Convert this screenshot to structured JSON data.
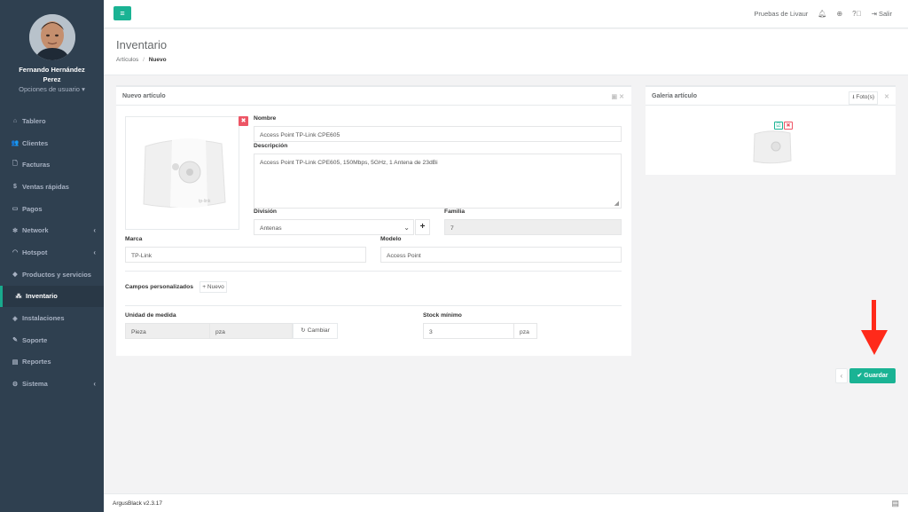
{
  "user": {
    "name": "Fernando Hernández Perez",
    "options": "Opciones de usuario"
  },
  "nav": [
    {
      "label": "Tablero",
      "icon": "dashboard-icon",
      "glyph": "⌂",
      "chevron": ""
    },
    {
      "label": "Clientes",
      "icon": "users-icon",
      "glyph": "👥",
      "chevron": ""
    },
    {
      "label": "Facturas",
      "icon": "document-icon",
      "glyph": "🗋",
      "chevron": ""
    },
    {
      "label": "Ventas rápidas",
      "icon": "dollar-icon",
      "glyph": "$",
      "chevron": ""
    },
    {
      "label": "Pagos",
      "icon": "money-icon",
      "glyph": "▭",
      "chevron": ""
    },
    {
      "label": "Network",
      "icon": "network-icon",
      "glyph": "✻",
      "chevron": "‹"
    },
    {
      "label": "Hotspot",
      "icon": "wifi-icon",
      "glyph": "◠",
      "chevron": "‹"
    },
    {
      "label": "Productos y servicios",
      "icon": "tag-icon",
      "glyph": "◆",
      "chevron": ""
    },
    {
      "label": "Inventario",
      "icon": "cubes-icon",
      "glyph": "⁂",
      "chevron": "",
      "active": true
    },
    {
      "label": "Instalaciones",
      "icon": "install-icon",
      "glyph": "◈",
      "chevron": ""
    },
    {
      "label": "Soporte",
      "icon": "wrench-icon",
      "glyph": "✎",
      "chevron": ""
    },
    {
      "label": "Reportes",
      "icon": "book-icon",
      "glyph": "▤",
      "chevron": ""
    },
    {
      "label": "Sistema",
      "icon": "gears-icon",
      "glyph": "⚙",
      "chevron": "‹"
    }
  ],
  "topbar": {
    "account": "Pruebas de Livaur",
    "logout": "Salir"
  },
  "page": {
    "title": "Inventario",
    "crumb_parent": "Artículos",
    "crumb_sep": "/",
    "crumb_current": "Nuevo"
  },
  "form": {
    "panel_title": "Nuevo artículo",
    "nombre_label": "Nombre",
    "nombre_value": "Access Point TP-Link CPE605",
    "descripcion_label": "Descripción",
    "descripcion_value": "Access Point TP-Link CPE605, 150Mbps, 5GHz, 1 Antena de 23dBi",
    "division_label": "División",
    "division_value": "Antenas",
    "familia_label": "Familia",
    "familia_value": "7",
    "marca_label": "Marca",
    "marca_value": "TP-Link",
    "modelo_label": "Modelo",
    "modelo_value": "Access Point",
    "campos_label": "Campos personalizados",
    "campos_new": "Nuevo",
    "unidad_label": "Unidad de medida",
    "unidad_value": "Pieza",
    "unidad_abbr": "pza",
    "cambiar": "Cambiar",
    "stock_label": "Stock mínimo",
    "stock_value": "3",
    "stock_unit": "pza",
    "product_brand_mark": "tp-link"
  },
  "gallery": {
    "title": "Galeria artículo",
    "fotos": "Foto(s)"
  },
  "actions": {
    "save": "Guardar"
  },
  "footer": {
    "version": "ArgusBlack v2.3.17"
  },
  "colors": {
    "accent": "#1ab394",
    "danger": "#ed5565",
    "sidebar": "#2f4050",
    "arrow": "#ff2a1a"
  }
}
